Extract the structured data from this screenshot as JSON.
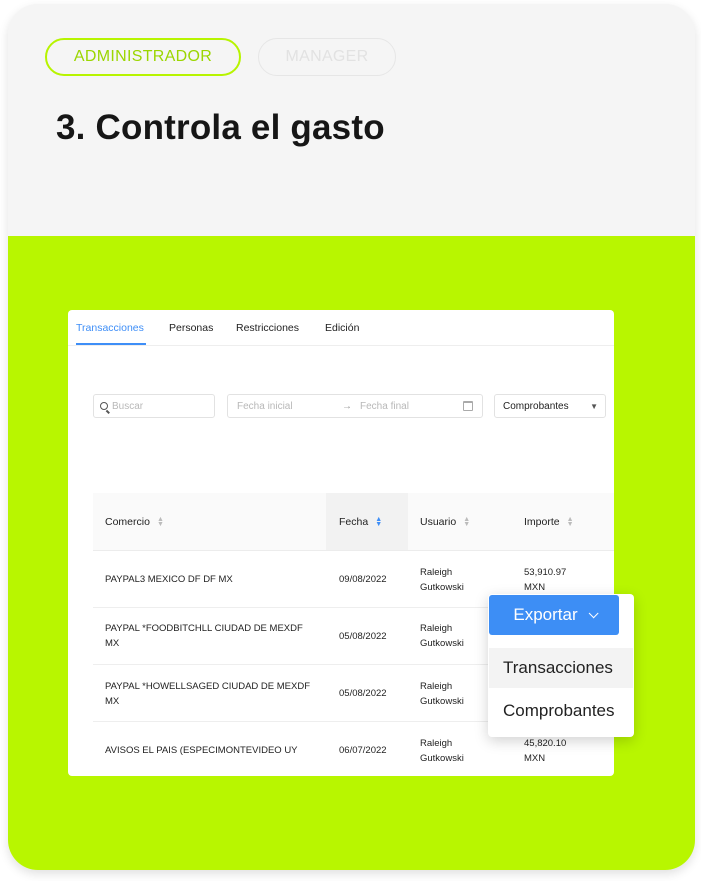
{
  "roles": {
    "admin": "ADMINISTRADOR",
    "manager": "MANAGER"
  },
  "heading": "3. Controla el gasto",
  "tabs": [
    "Transacciones",
    "Personas",
    "Restricciones",
    "Edición"
  ],
  "filters": {
    "search_placeholder": "Buscar",
    "date_start": "Fecha inicial",
    "date_end": "Fecha final",
    "select_value": "Comprobantes"
  },
  "table": {
    "headers": [
      "Comercio",
      "Fecha",
      "Usuario",
      "Importe"
    ],
    "rows": [
      {
        "comercio": "PAYPAL3 MEXICO DF DF MX",
        "fecha": "09/08/2022",
        "usuario": "Raleigh Gutkowski",
        "importe": "53,910.97 MXN"
      },
      {
        "comercio": "PAYPAL *FOODBITCHLL CIUDAD DE MEXDF MX",
        "fecha": "05/08/2022",
        "usuario": "Raleigh Gutkowski",
        "importe": ""
      },
      {
        "comercio": "PAYPAL *HOWELLSAGED CIUDAD DE MEXDF MX",
        "fecha": "05/08/2022",
        "usuario": "Raleigh Gutkowski",
        "importe": ""
      },
      {
        "comercio": "AVISOS EL PAIS (ESPECIMONTEVIDEO UY",
        "fecha": "06/07/2022",
        "usuario": "Raleigh Gutkowski",
        "importe": "45,820.10 MXN"
      }
    ]
  },
  "export_menu": {
    "button_label": "Exportar",
    "items": [
      "Transacciones",
      "Comprobantes"
    ]
  },
  "colors": {
    "lime": "#b8f600",
    "blue": "#3d8ef5"
  }
}
